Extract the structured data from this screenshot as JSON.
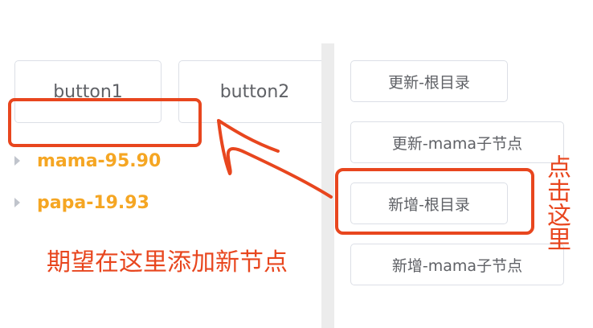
{
  "top_buttons": {
    "button1_label": "button1",
    "button2_label": "button2"
  },
  "tree": {
    "nodes": [
      {
        "label": "mama-95.90"
      },
      {
        "label": "papa-19.93"
      }
    ]
  },
  "right_panel": {
    "buttons": [
      {
        "label": "更新-根目录"
      },
      {
        "label": "更新-mama子节点"
      },
      {
        "label": "新增-根目录"
      },
      {
        "label": "新增-mama子节点"
      }
    ]
  },
  "annotations": {
    "hope_text": "期望在这里添加新节点",
    "click_here": "点击这里",
    "color": "#e8461e"
  },
  "colors": {
    "node_text": "#f5a623",
    "button_border": "#dcdfe6",
    "button_text": "#5f6166",
    "divider": "#ececec"
  }
}
